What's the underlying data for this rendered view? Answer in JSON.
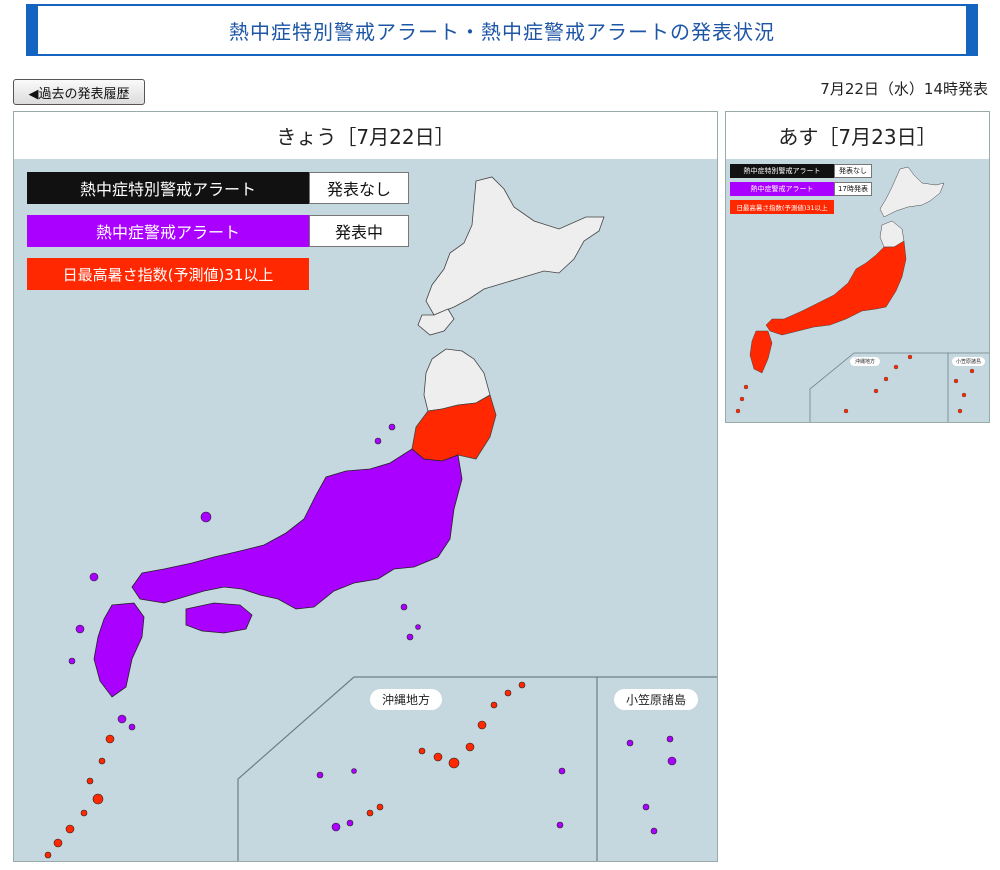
{
  "header": {
    "title": "熱中症特別警戒アラート・熱中症警戒アラートの発表状況"
  },
  "toolbar": {
    "history_button": "◀過去の発表履歴"
  },
  "issued_time": "7月22日（水）14時発表",
  "today": {
    "title": "きょう［7月22日］",
    "legend": {
      "special_alert_label": "熱中症特別警戒アラート",
      "special_alert_status": "発表なし",
      "alert_label": "熱中症警戒アラート",
      "alert_status": "発表中",
      "wbgt_label": "日最高暑さ指数(予測値)31以上"
    },
    "inset_okinawa": "沖縄地方",
    "inset_ogasawara": "小笠原諸島"
  },
  "tomorrow": {
    "title": "あす［7月23日］",
    "legend": {
      "special_alert_label": "熱中症特別警戒アラート",
      "special_alert_status": "発表なし",
      "alert_label": "熱中症警戒アラート",
      "alert_status": "17時発表",
      "wbgt_label": "日最高暑さ指数(予測値)31以上"
    },
    "inset_okinawa": "沖縄地方",
    "inset_ogasawara": "小笠原諸島"
  },
  "colors": {
    "special_alert": "#111111",
    "alert": "#aa00ff",
    "wbgt31": "#ff2800",
    "no_alert_land": "#eeeeee",
    "sea": "#c6d8df",
    "title_accent": "#1565c0"
  }
}
